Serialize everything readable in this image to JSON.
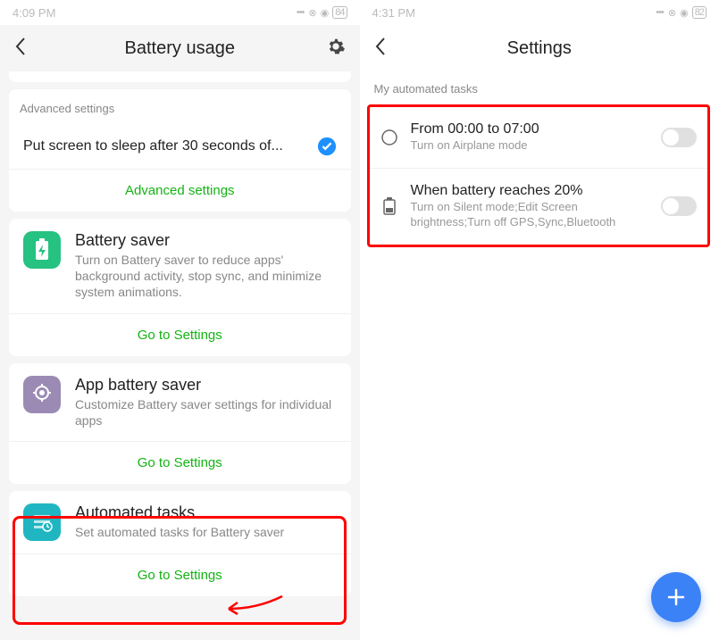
{
  "left": {
    "status_time": "4:09 PM",
    "battery": "84",
    "header_title": "Battery usage",
    "advanced_label": "Advanced settings",
    "sleep_text": "Put screen to sleep after 30 seconds of...",
    "advanced_link": "Advanced settings",
    "cards": [
      {
        "title": "Battery saver",
        "sub": "Turn on Battery saver to reduce apps' background activity, stop sync, and minimize system animations.",
        "link": "Go to Settings"
      },
      {
        "title": "App battery saver",
        "sub": "Customize Battery saver settings for individual apps",
        "link": "Go to Settings"
      },
      {
        "title": "Automated tasks",
        "sub": "Set automated tasks for Battery saver",
        "link": "Go to Settings"
      }
    ]
  },
  "right": {
    "status_time": "4:31 PM",
    "battery": "82",
    "header_title": "Settings",
    "section_label": "My automated tasks",
    "tasks": [
      {
        "title": "From 00:00 to 07:00",
        "sub": "Turn on Airplane mode"
      },
      {
        "title": "When battery reaches 20%",
        "sub": "Turn on Silent mode;Edit Screen brightness;Turn off GPS,Sync,Bluetooth"
      }
    ]
  }
}
